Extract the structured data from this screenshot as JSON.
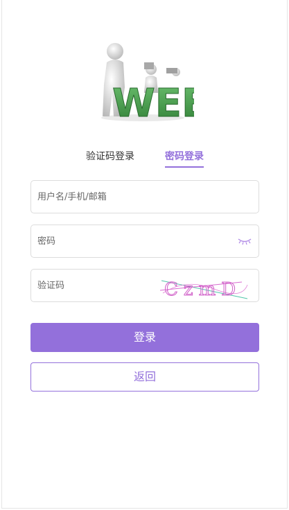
{
  "logo": {
    "text": "WEB",
    "icon": "web-3d-figures-logo"
  },
  "tabs": [
    {
      "label": "验证码登录",
      "active": false
    },
    {
      "label": "密码登录",
      "active": true
    }
  ],
  "form": {
    "username_placeholder": "用户名/手机/邮箱",
    "password_placeholder": "密码",
    "code_placeholder": "验证码",
    "password_toggle_icon": "eye-closed-icon",
    "captcha_text": "CzmD"
  },
  "buttons": {
    "login_label": "登录",
    "back_label": "返回"
  },
  "colors": {
    "accent": "#9370db",
    "logo_green": "#4a9a4e",
    "border": "#dcdcdc"
  }
}
